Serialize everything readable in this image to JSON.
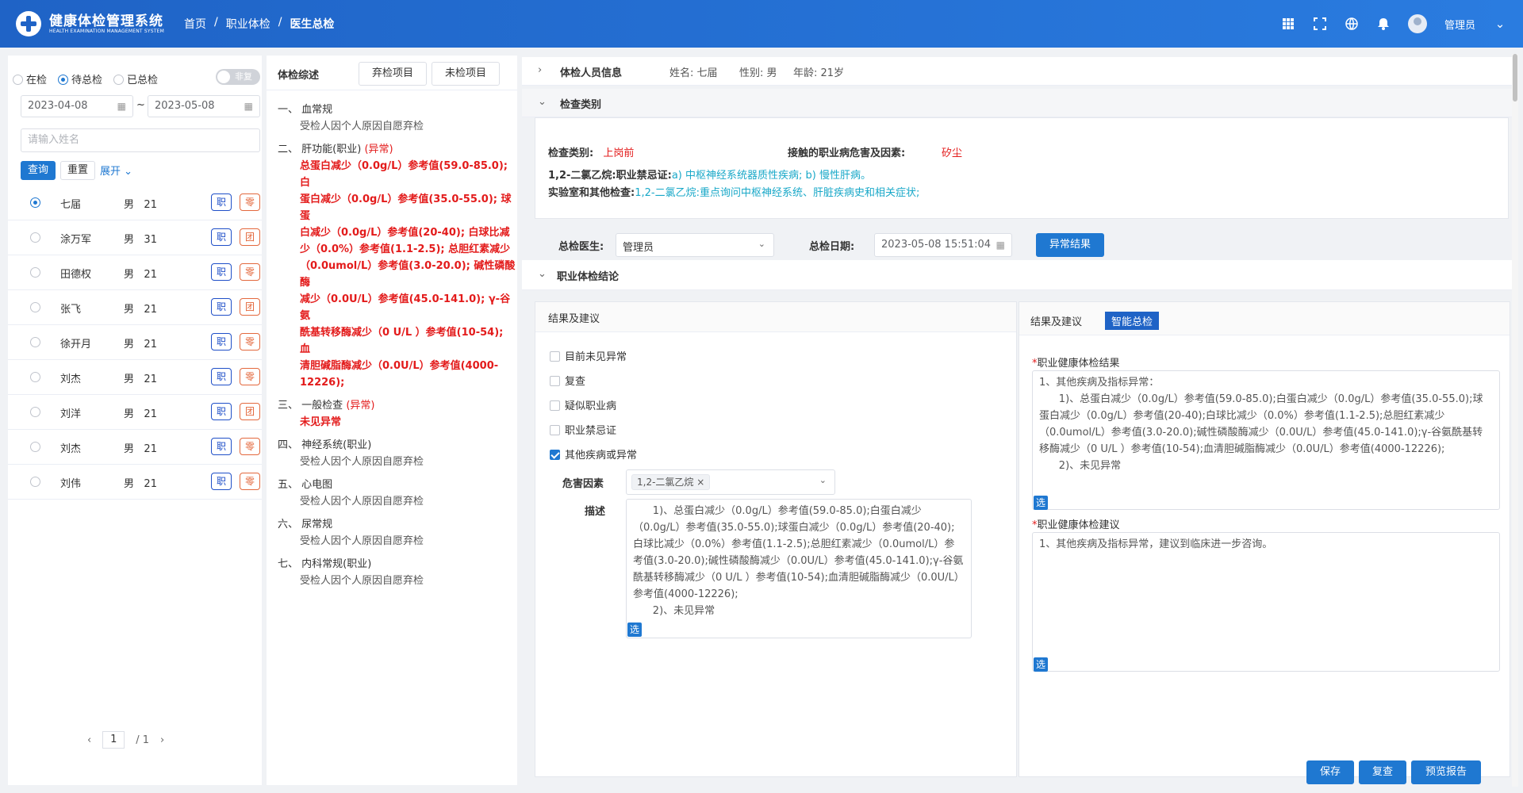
{
  "header": {
    "app_title": "健康体检管理系统",
    "app_subtitle": "HEALTH EXAMINATION MANAGEMENT SYSTEM",
    "breadcrumb": [
      "首页",
      "职业体检",
      "医生总检"
    ],
    "breadcrumb_sep": "/",
    "user": "管理员"
  },
  "left": {
    "radios": [
      "在检",
      "待总检",
      "已总检"
    ],
    "selected_radio": "待总检",
    "switch_label": "非复",
    "date_from": "2023-04-08",
    "date_to": "2023-05-08",
    "date_sep": "~",
    "name_placeholder": "请输入姓名",
    "query_btn": "查询",
    "reset_btn": "重置",
    "expand_link": "展开",
    "persons": [
      {
        "name": "七届",
        "gender": "男",
        "age": "21",
        "tag1": "职",
        "tag2": "零",
        "selected": true
      },
      {
        "name": "涂万军",
        "gender": "男",
        "age": "31",
        "tag1": "职",
        "tag2": "团"
      },
      {
        "name": "田德权",
        "gender": "男",
        "age": "21",
        "tag1": "职",
        "tag2": "零"
      },
      {
        "name": "张飞",
        "gender": "男",
        "age": "21",
        "tag1": "职",
        "tag2": "团"
      },
      {
        "name": "徐开月",
        "gender": "男",
        "age": "21",
        "tag1": "职",
        "tag2": "零"
      },
      {
        "name": "刘杰",
        "gender": "男",
        "age": "21",
        "tag1": "职",
        "tag2": "零"
      },
      {
        "name": "刘洋",
        "gender": "男",
        "age": "21",
        "tag1": "职",
        "tag2": "团"
      },
      {
        "name": "刘杰",
        "gender": "男",
        "age": "21",
        "tag1": "职",
        "tag2": "零"
      },
      {
        "name": "刘伟",
        "gender": "男",
        "age": "21",
        "tag1": "职",
        "tag2": "零"
      }
    ],
    "pager": {
      "prev": "‹",
      "page": "1",
      "total": "/ 1",
      "next": "›"
    }
  },
  "middle": {
    "title": "体检综述",
    "btn_abandon": "弃检项目",
    "btn_unchecked": "未检项目",
    "sections": [
      {
        "num": "一、",
        "name": "血常规",
        "flag": "",
        "lines": [
          "受检人因个人原因自愿弃检"
        ],
        "abnormal": false
      },
      {
        "num": "二、",
        "name": "肝功能(职业)",
        "flag": "(异常)",
        "lines": [
          "总蛋白减少（0.0g/L）参考值(59.0-85.0); 白",
          "蛋白减少（0.0g/L）参考值(35.0-55.0); 球蛋",
          "白减少（0.0g/L）参考值(20-40); 白球比减",
          "少（0.0%）参考值(1.1-2.5); 总胆红素减少",
          "（0.0umol/L）参考值(3.0-20.0); 碱性磷酸酶",
          "减少（0.0U/L）参考值(45.0-141.0); γ-谷氨",
          "酰基转移酶减少（0 U/L ）参考值(10-54); 血",
          "清胆碱脂酶减少（0.0U/L）参考值(4000-",
          "12226);"
        ],
        "abnormal": true
      },
      {
        "num": "三、",
        "name": "一般检查",
        "flag": "(异常)",
        "lines": [
          "未见异常"
        ],
        "abnormal": true
      },
      {
        "num": "四、",
        "name": "神经系统(职业)",
        "flag": "",
        "lines": [
          "受检人因个人原因自愿弃检"
        ],
        "abnormal": false
      },
      {
        "num": "五、",
        "name": "心电图",
        "flag": "",
        "lines": [
          "受检人因个人原因自愿弃检"
        ],
        "abnormal": false
      },
      {
        "num": "六、",
        "name": "尿常规",
        "flag": "",
        "lines": [
          "受检人因个人原因自愿弃检"
        ],
        "abnormal": false
      },
      {
        "num": "七、",
        "name": "内科常规(职业)",
        "flag": "",
        "lines": [
          "受检人因个人原因自愿弃检"
        ],
        "abnormal": false
      }
    ]
  },
  "right": {
    "person_info_label": "体检人员信息",
    "name_field": "姓名: 七届",
    "gender_field": "性别: 男",
    "age_field": "年龄: 21岁",
    "category_section": "检查类别",
    "exam_type_label": "检查类别:",
    "exam_type_value": "上岗前",
    "hazard_label": "接触的职业病危害及因素:",
    "hazard_value": "矽尘",
    "contra_label": "1,2-二氯乙烷:职业禁忌证:",
    "contra_value": "a) 中枢神经系统器质性疾病;   b) 慢性肝病。",
    "lab_label": "实验室和其他检查:",
    "lab_value": "1,2-二氯乙烷:重点询问中枢神经系统、肝脏疾病史和相关症状;",
    "doctor_label": "总检医生:",
    "doctor_value": "管理员",
    "date_label": "总检日期:",
    "date_value": "2023-05-08 15:51:04",
    "abnormal_btn": "异常结果",
    "conclusion_section": "职业体检结论",
    "left_tab": "结果及建议",
    "checks": [
      {
        "label": "目前未见异常",
        "checked": false
      },
      {
        "label": "复查",
        "checked": false
      },
      {
        "label": "疑似职业病",
        "checked": false
      },
      {
        "label": "职业禁忌证",
        "checked": false
      },
      {
        "label": "其他疾病或异常",
        "checked": true
      }
    ],
    "factor_label": "危害因素",
    "factor_chip": "1,2-二氯乙烷 ×",
    "desc_label": "描述",
    "desc_text": "      1)、总蛋白减少（0.0g/L）参考值(59.0-85.0);白蛋白减少（0.0g/L）参考值(35.0-55.0);球蛋白减少（0.0g/L）参考值(20-40);白球比减少（0.0%）参考值(1.1-2.5);总胆红素减少（0.0umol/L）参考值(3.0-20.0);碱性磷酸酶减少（0.0U/L）参考值(45.0-141.0);γ-谷氨酰基转移酶减少（0 U/L ）参考值(10-54);血清胆碱脂酶减少（0.0U/L）参考值(4000-12226);\n      2)、未见异常",
    "sel": "选",
    "right_tab1": "结果及建议",
    "right_tab2": "智能总检",
    "result_label": "职业健康体检结果",
    "result_text": "1、其他疾病及指标异常：\n      1)、总蛋白减少（0.0g/L）参考值(59.0-85.0);白蛋白减少（0.0g/L）参考值(35.0-55.0);球蛋白减少（0.0g/L）参考值(20-40);白球比减少（0.0%）参考值(1.1-2.5);总胆红素减少（0.0umol/L）参考值(3.0-20.0);碱性磷酸酶减少（0.0U/L）参考值(45.0-141.0);γ-谷氨酰基转移酶减少（0 U/L ）参考值(10-54);血清胆碱脂酶减少（0.0U/L）参考值(4000-12226);\n      2)、未见异常",
    "advice_label": "职业健康体检建议",
    "advice_text": "1、其他疾病及指标异常，建议到临床进一步咨询。",
    "save_btn": "保存",
    "recheck_btn": "复查",
    "preview_btn": "预览报告"
  },
  "colors": {
    "primary": "#1f78d1",
    "header": "#1f63c6",
    "abnormal": "#e31b1b",
    "teal": "#19a8c8"
  }
}
